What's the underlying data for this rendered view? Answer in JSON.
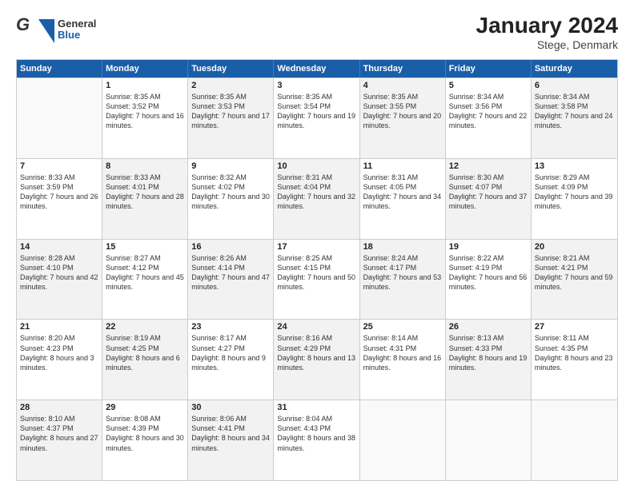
{
  "header": {
    "logo_general": "General",
    "logo_blue": "Blue",
    "title": "January 2024",
    "subtitle": "Stege, Denmark"
  },
  "days": [
    "Sunday",
    "Monday",
    "Tuesday",
    "Wednesday",
    "Thursday",
    "Friday",
    "Saturday"
  ],
  "weeks": [
    [
      {
        "day": "",
        "empty": true
      },
      {
        "day": "1",
        "sunrise": "Sunrise: 8:35 AM",
        "sunset": "Sunset: 3:52 PM",
        "daylight": "Daylight: 7 hours and 16 minutes."
      },
      {
        "day": "2",
        "sunrise": "Sunrise: 8:35 AM",
        "sunset": "Sunset: 3:53 PM",
        "daylight": "Daylight: 7 hours and 17 minutes."
      },
      {
        "day": "3",
        "sunrise": "Sunrise: 8:35 AM",
        "sunset": "Sunset: 3:54 PM",
        "daylight": "Daylight: 7 hours and 19 minutes."
      },
      {
        "day": "4",
        "sunrise": "Sunrise: 8:35 AM",
        "sunset": "Sunset: 3:55 PM",
        "daylight": "Daylight: 7 hours and 20 minutes."
      },
      {
        "day": "5",
        "sunrise": "Sunrise: 8:34 AM",
        "sunset": "Sunset: 3:56 PM",
        "daylight": "Daylight: 7 hours and 22 minutes."
      },
      {
        "day": "6",
        "sunrise": "Sunrise: 8:34 AM",
        "sunset": "Sunset: 3:58 PM",
        "daylight": "Daylight: 7 hours and 24 minutes."
      }
    ],
    [
      {
        "day": "7",
        "sunrise": "Sunrise: 8:33 AM",
        "sunset": "Sunset: 3:59 PM",
        "daylight": "Daylight: 7 hours and 26 minutes."
      },
      {
        "day": "8",
        "sunrise": "Sunrise: 8:33 AM",
        "sunset": "Sunset: 4:01 PM",
        "daylight": "Daylight: 7 hours and 28 minutes."
      },
      {
        "day": "9",
        "sunrise": "Sunrise: 8:32 AM",
        "sunset": "Sunset: 4:02 PM",
        "daylight": "Daylight: 7 hours and 30 minutes."
      },
      {
        "day": "10",
        "sunrise": "Sunrise: 8:31 AM",
        "sunset": "Sunset: 4:04 PM",
        "daylight": "Daylight: 7 hours and 32 minutes."
      },
      {
        "day": "11",
        "sunrise": "Sunrise: 8:31 AM",
        "sunset": "Sunset: 4:05 PM",
        "daylight": "Daylight: 7 hours and 34 minutes."
      },
      {
        "day": "12",
        "sunrise": "Sunrise: 8:30 AM",
        "sunset": "Sunset: 4:07 PM",
        "daylight": "Daylight: 7 hours and 37 minutes."
      },
      {
        "day": "13",
        "sunrise": "Sunrise: 8:29 AM",
        "sunset": "Sunset: 4:09 PM",
        "daylight": "Daylight: 7 hours and 39 minutes."
      }
    ],
    [
      {
        "day": "14",
        "sunrise": "Sunrise: 8:28 AM",
        "sunset": "Sunset: 4:10 PM",
        "daylight": "Daylight: 7 hours and 42 minutes."
      },
      {
        "day": "15",
        "sunrise": "Sunrise: 8:27 AM",
        "sunset": "Sunset: 4:12 PM",
        "daylight": "Daylight: 7 hours and 45 minutes."
      },
      {
        "day": "16",
        "sunrise": "Sunrise: 8:26 AM",
        "sunset": "Sunset: 4:14 PM",
        "daylight": "Daylight: 7 hours and 47 minutes."
      },
      {
        "day": "17",
        "sunrise": "Sunrise: 8:25 AM",
        "sunset": "Sunset: 4:15 PM",
        "daylight": "Daylight: 7 hours and 50 minutes."
      },
      {
        "day": "18",
        "sunrise": "Sunrise: 8:24 AM",
        "sunset": "Sunset: 4:17 PM",
        "daylight": "Daylight: 7 hours and 53 minutes."
      },
      {
        "day": "19",
        "sunrise": "Sunrise: 8:22 AM",
        "sunset": "Sunset: 4:19 PM",
        "daylight": "Daylight: 7 hours and 56 minutes."
      },
      {
        "day": "20",
        "sunrise": "Sunrise: 8:21 AM",
        "sunset": "Sunset: 4:21 PM",
        "daylight": "Daylight: 7 hours and 59 minutes."
      }
    ],
    [
      {
        "day": "21",
        "sunrise": "Sunrise: 8:20 AM",
        "sunset": "Sunset: 4:23 PM",
        "daylight": "Daylight: 8 hours and 3 minutes."
      },
      {
        "day": "22",
        "sunrise": "Sunrise: 8:19 AM",
        "sunset": "Sunset: 4:25 PM",
        "daylight": "Daylight: 8 hours and 6 minutes."
      },
      {
        "day": "23",
        "sunrise": "Sunrise: 8:17 AM",
        "sunset": "Sunset: 4:27 PM",
        "daylight": "Daylight: 8 hours and 9 minutes."
      },
      {
        "day": "24",
        "sunrise": "Sunrise: 8:16 AM",
        "sunset": "Sunset: 4:29 PM",
        "daylight": "Daylight: 8 hours and 13 minutes."
      },
      {
        "day": "25",
        "sunrise": "Sunrise: 8:14 AM",
        "sunset": "Sunset: 4:31 PM",
        "daylight": "Daylight: 8 hours and 16 minutes."
      },
      {
        "day": "26",
        "sunrise": "Sunrise: 8:13 AM",
        "sunset": "Sunset: 4:33 PM",
        "daylight": "Daylight: 8 hours and 19 minutes."
      },
      {
        "day": "27",
        "sunrise": "Sunrise: 8:11 AM",
        "sunset": "Sunset: 4:35 PM",
        "daylight": "Daylight: 8 hours and 23 minutes."
      }
    ],
    [
      {
        "day": "28",
        "sunrise": "Sunrise: 8:10 AM",
        "sunset": "Sunset: 4:37 PM",
        "daylight": "Daylight: 8 hours and 27 minutes."
      },
      {
        "day": "29",
        "sunrise": "Sunrise: 8:08 AM",
        "sunset": "Sunset: 4:39 PM",
        "daylight": "Daylight: 8 hours and 30 minutes."
      },
      {
        "day": "30",
        "sunrise": "Sunrise: 8:06 AM",
        "sunset": "Sunset: 4:41 PM",
        "daylight": "Daylight: 8 hours and 34 minutes."
      },
      {
        "day": "31",
        "sunrise": "Sunrise: 8:04 AM",
        "sunset": "Sunset: 4:43 PM",
        "daylight": "Daylight: 8 hours and 38 minutes."
      },
      {
        "day": "",
        "empty": true
      },
      {
        "day": "",
        "empty": true
      },
      {
        "day": "",
        "empty": true
      }
    ]
  ]
}
